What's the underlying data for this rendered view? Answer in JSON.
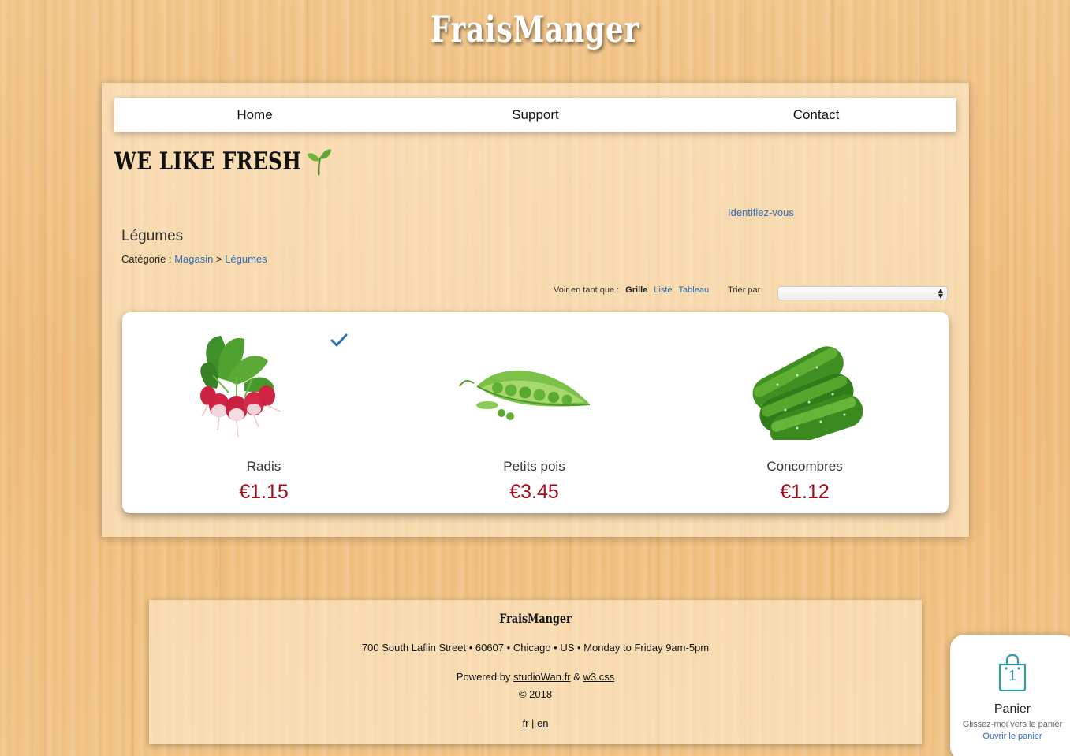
{
  "site": {
    "title": "FraisManger"
  },
  "nav": {
    "items": [
      {
        "label": "Home"
      },
      {
        "label": "Support"
      },
      {
        "label": "Contact"
      }
    ]
  },
  "header": {
    "tagline": "We like fresh",
    "tagline_icon": "sprout-icon",
    "login_link": "Identifiez-vous"
  },
  "category": {
    "title": "Légumes",
    "breadcrumb_prefix": "Catégorie :",
    "breadcrumb_root": "Magasin",
    "breadcrumb_sep": ">",
    "breadcrumb_current": "Légumes"
  },
  "view": {
    "label": "Voir en tant que :",
    "options": [
      {
        "label": "Grille",
        "active": true
      },
      {
        "label": "Liste",
        "active": false
      },
      {
        "label": "Tableau",
        "active": false
      }
    ],
    "sort_label": "Trier par",
    "sort_value": ""
  },
  "products": [
    {
      "name": "Radis",
      "price": "€1.15",
      "image": "radish-image",
      "checked": true
    },
    {
      "name": "Petits pois",
      "price": "€3.45",
      "image": "peas-image",
      "checked": false
    },
    {
      "name": "Concombres",
      "price": "€1.12",
      "image": "cucumber-image",
      "checked": false
    }
  ],
  "footer": {
    "brand": "FraisManger",
    "address": "700 South Laflin Street • 60607 • Chicago • US • Monday to Friday 9am-5pm",
    "powered_prefix": "Powered by",
    "powered_link1": "studioWan.fr",
    "powered_amp": "&",
    "powered_link2": "w3.css",
    "copyright": "© 2018",
    "lang_fr": "fr",
    "lang_sep": "|",
    "lang_en": "en"
  },
  "cart": {
    "count": "1",
    "title": "Panier",
    "subtitle": "Glissez-moi vers le panier",
    "link": "Ouvrir le panier",
    "accent_color": "#2e9ea6"
  },
  "colors": {
    "price": "#a30d1b",
    "link": "#2a6db8"
  }
}
